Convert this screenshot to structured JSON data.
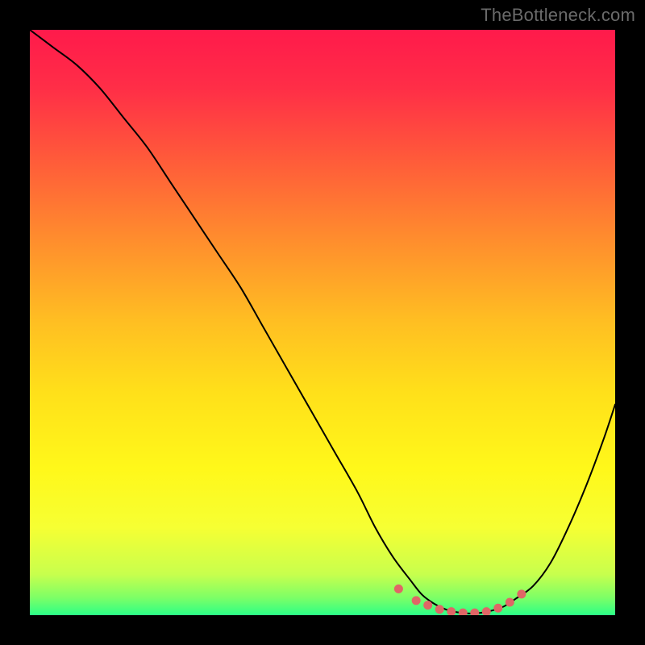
{
  "watermark": "TheBottleneck.com",
  "gradient": {
    "stops": [
      {
        "offset": 0.0,
        "color": "#ff1a4b"
      },
      {
        "offset": 0.1,
        "color": "#ff2e47"
      },
      {
        "offset": 0.22,
        "color": "#ff5a3a"
      },
      {
        "offset": 0.35,
        "color": "#ff8a2e"
      },
      {
        "offset": 0.5,
        "color": "#ffbf22"
      },
      {
        "offset": 0.62,
        "color": "#ffe01a"
      },
      {
        "offset": 0.75,
        "color": "#fff81a"
      },
      {
        "offset": 0.85,
        "color": "#f6ff33"
      },
      {
        "offset": 0.93,
        "color": "#c8ff4d"
      },
      {
        "offset": 0.97,
        "color": "#7dff66"
      },
      {
        "offset": 1.0,
        "color": "#2cff87"
      }
    ]
  },
  "chart_data": {
    "type": "line",
    "title": "",
    "xlabel": "",
    "ylabel": "",
    "xlim": [
      0,
      100
    ],
    "ylim": [
      0,
      100
    ],
    "grid": false,
    "series": [
      {
        "name": "bottleneck-curve",
        "x": [
          0,
          4,
          8,
          12,
          16,
          20,
          24,
          28,
          32,
          36,
          40,
          44,
          48,
          52,
          56,
          59,
          62,
          65,
          67,
          69,
          71,
          73,
          75,
          77,
          79,
          81,
          83,
          86,
          89,
          92,
          95,
          98,
          100
        ],
        "y": [
          100,
          97,
          94,
          90,
          85,
          80,
          74,
          68,
          62,
          56,
          49,
          42,
          35,
          28,
          21,
          15,
          10,
          6,
          3.5,
          2,
          1,
          0.5,
          0.3,
          0.4,
          0.8,
          1.5,
          2.8,
          5,
          9,
          15,
          22,
          30,
          36
        ]
      }
    ],
    "markers": {
      "name": "optimal-range-markers",
      "color": "#e06666",
      "points": [
        {
          "x": 63,
          "y": 4.5
        },
        {
          "x": 66,
          "y": 2.5
        },
        {
          "x": 68,
          "y": 1.7
        },
        {
          "x": 70,
          "y": 1.0
        },
        {
          "x": 72,
          "y": 0.6
        },
        {
          "x": 74,
          "y": 0.4
        },
        {
          "x": 76,
          "y": 0.4
        },
        {
          "x": 78,
          "y": 0.6
        },
        {
          "x": 80,
          "y": 1.2
        },
        {
          "x": 82,
          "y": 2.2
        },
        {
          "x": 84,
          "y": 3.6
        }
      ]
    }
  }
}
